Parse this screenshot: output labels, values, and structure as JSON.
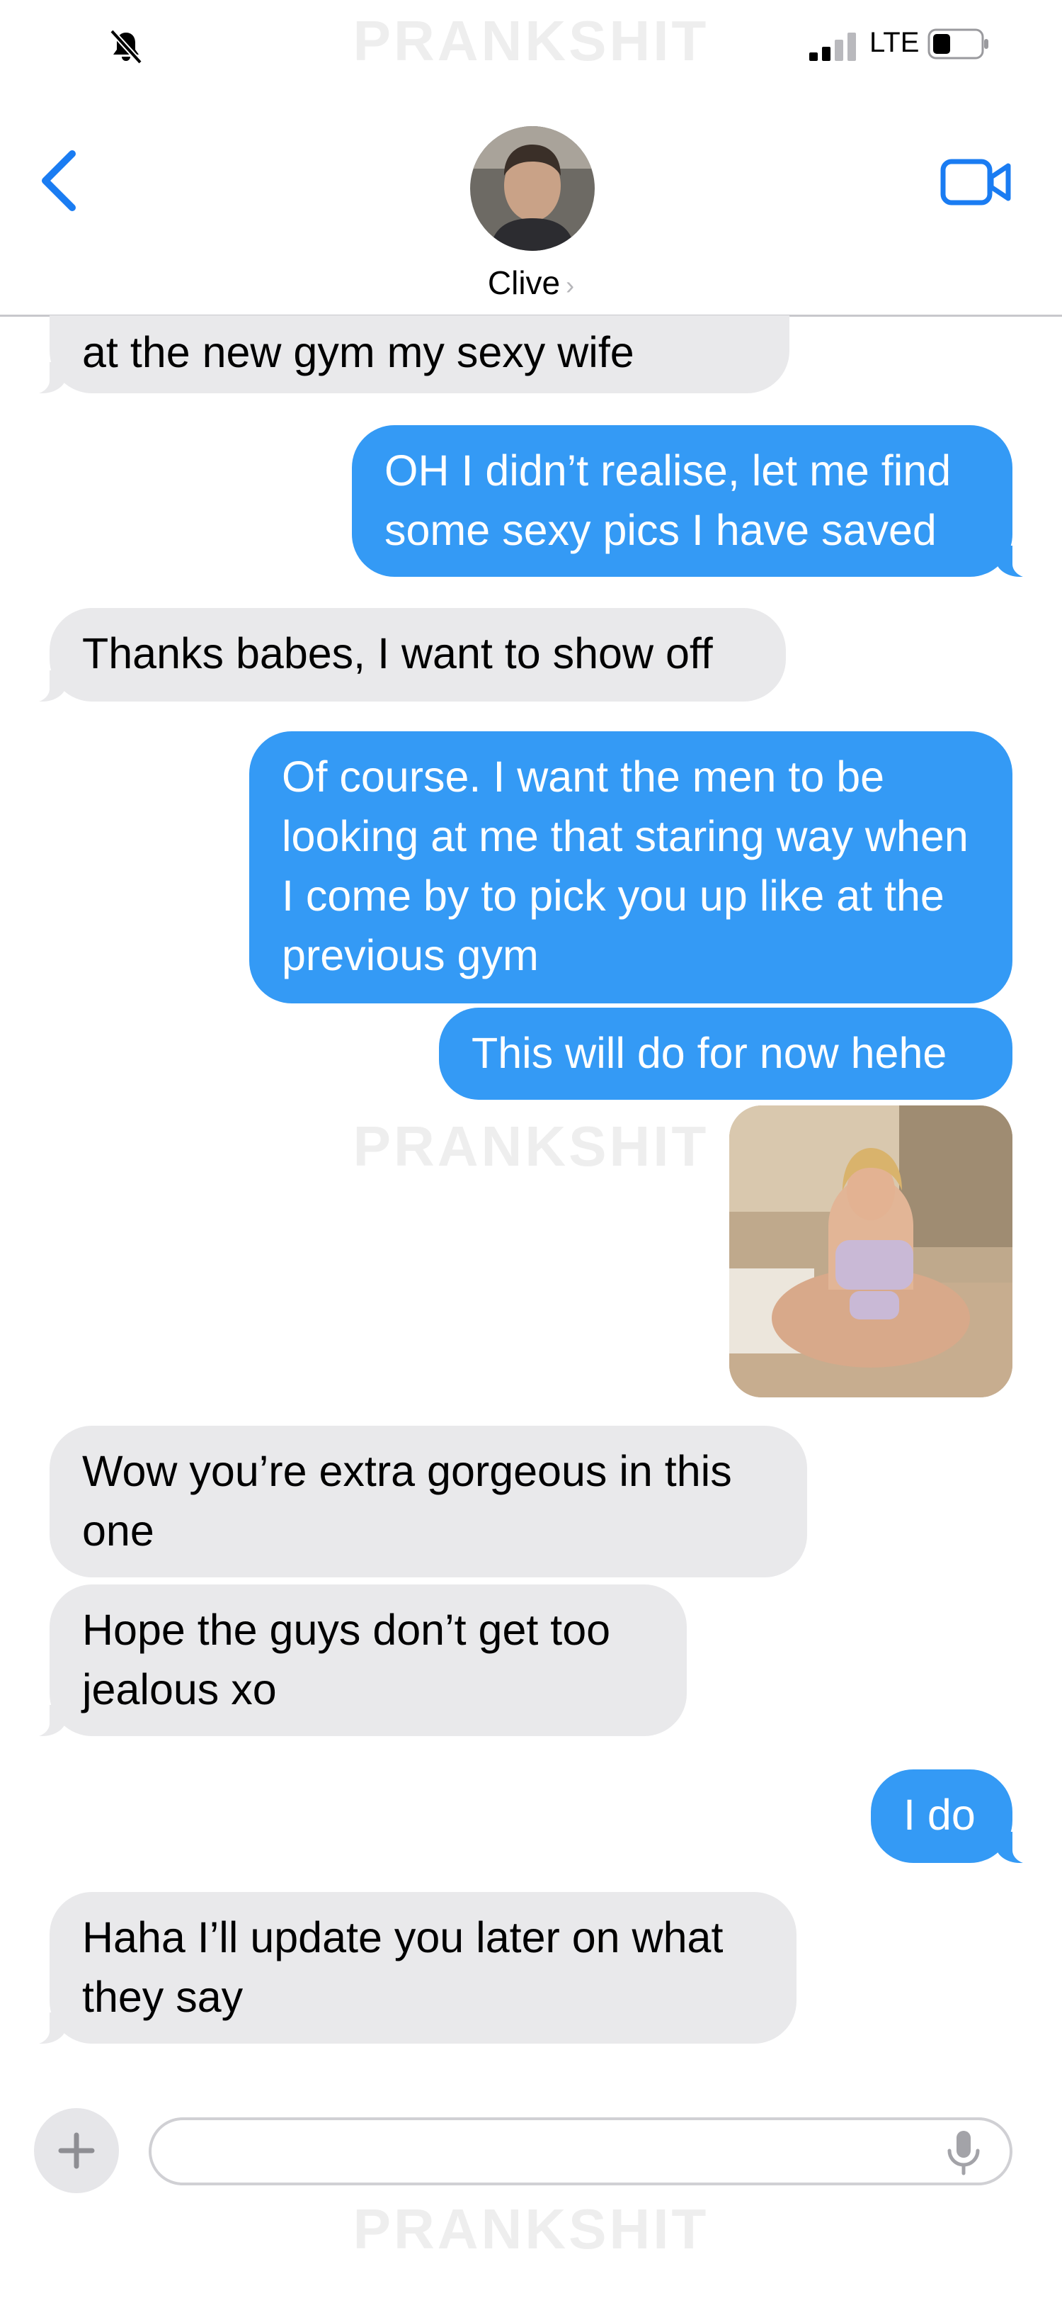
{
  "watermark": "PRANKSHIT",
  "status_bar": {
    "network": "LTE",
    "icons": [
      "bell-muted-icon",
      "signal-icon",
      "battery-icon"
    ]
  },
  "header": {
    "contact_name": "Clive",
    "chevron": "›",
    "icons": [
      "back-chevron-icon",
      "video-camera-icon"
    ]
  },
  "messages": [
    {
      "side": "incoming",
      "text": "at the new gym my sexy wife"
    },
    {
      "side": "outgoing",
      "text": "OH I didn’t realise, let me find some sexy pics I have saved"
    },
    {
      "side": "incoming",
      "text": "Thanks babes, I want to show off"
    },
    {
      "side": "outgoing",
      "text": "Of course. I want the men to be looking at me that staring way when I come by to pick you up like at the previous gym"
    },
    {
      "side": "outgoing",
      "text": "This will do for now hehe"
    },
    {
      "side": "outgoing",
      "type": "photo"
    },
    {
      "side": "incoming",
      "text": "Wow you’re extra gorgeous in this one"
    },
    {
      "side": "incoming",
      "text": "Hope the guys don’t get too jealous xo"
    },
    {
      "side": "outgoing",
      "text": "I do"
    },
    {
      "side": "incoming",
      "text": "Haha I’ll update you later on what they say"
    }
  ],
  "compose": {
    "placeholder": "",
    "icons": [
      "plus-icon",
      "microphone-icon"
    ]
  },
  "colors": {
    "outgoing_bubble": "#349af5",
    "incoming_bubble": "#e9e9eb",
    "accent": "#1a7cf2"
  }
}
